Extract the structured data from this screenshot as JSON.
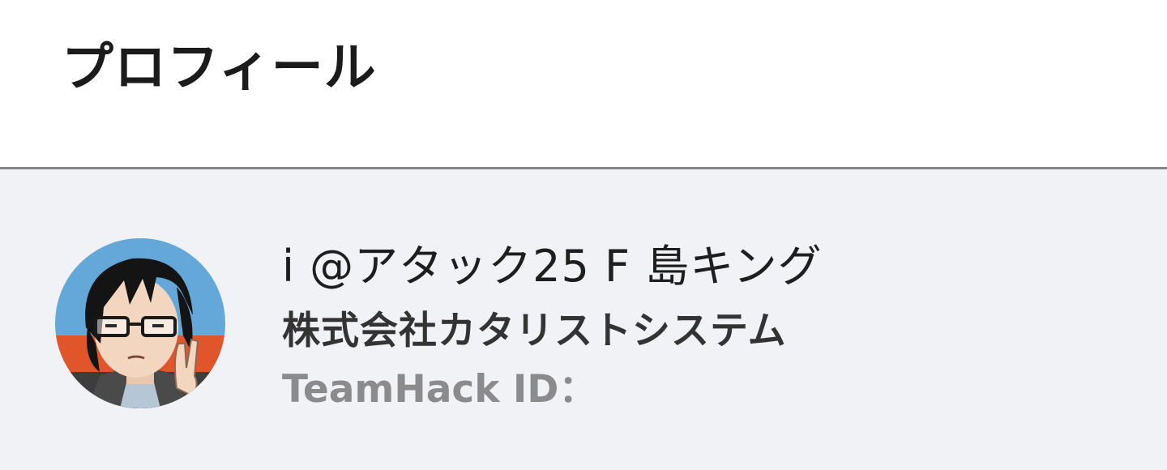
{
  "profile": {
    "title": "プロフィール",
    "user": {
      "display_name": "i @アタック25 F 島キング",
      "company": "株式会社カタリストシステム",
      "teamhack_label": "TeamHack ID：",
      "teamhack_id": ""
    },
    "avatar": {
      "icon": "avatar-illustration",
      "colors": {
        "sky": "#63a8d8",
        "stripe": "#e0562a",
        "hair": "#141414",
        "skin": "#f2d6c0"
      }
    }
  },
  "colors": {
    "header_bg": "#ffffff",
    "body_bg": "#f1f2f5",
    "divider": "#85868d",
    "title_text": "#1b1b1b",
    "name_text": "#1e1e1e",
    "muted_text": "#8b8b8d"
  }
}
